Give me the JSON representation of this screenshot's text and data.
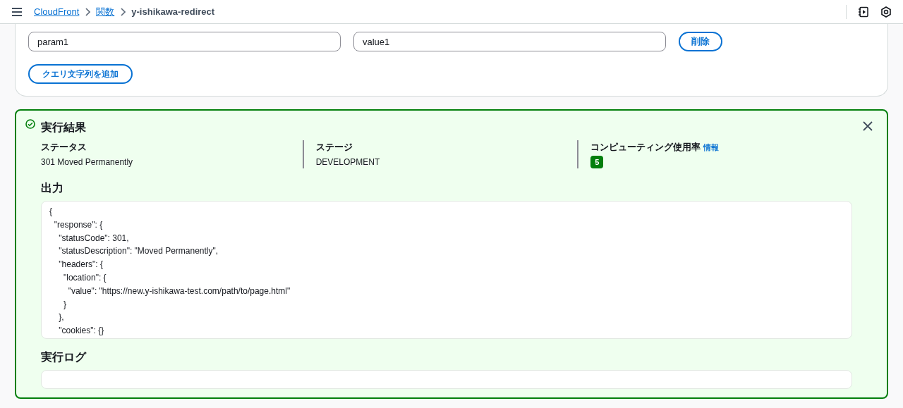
{
  "header": {
    "breadcrumbs": [
      {
        "label": "CloudFront",
        "link": true
      },
      {
        "label": "関数",
        "link": true
      },
      {
        "label": "y-ishikawa-redirect",
        "link": false
      }
    ]
  },
  "query_strings": {
    "rows": [
      {
        "key": "param1",
        "value": "value1",
        "remove_label": "削除"
      }
    ],
    "add_label": "クエリ文字列を追加"
  },
  "result": {
    "title": "実行結果",
    "kind": "success",
    "fields": [
      {
        "label": "ステータス",
        "value": "301 Moved Permanently",
        "kind": "text"
      },
      {
        "label": "ステージ",
        "value": "DEVELOPMENT",
        "kind": "text"
      },
      {
        "label": "コンピューティング使用率",
        "info": "情報",
        "value": "5",
        "kind": "badge"
      }
    ],
    "output": {
      "label": "出力",
      "value": "{\n  \"response\": {\n    \"statusCode\": 301,\n    \"statusDescription\": \"Moved Permanently\",\n    \"headers\": {\n      \"location\": {\n        \"value\": \"https://new.y-ishikawa-test.com/path/to/page.html\"\n      }\n    },\n    \"cookies\": {}"
    },
    "log": {
      "label": "実行ログ"
    }
  }
}
